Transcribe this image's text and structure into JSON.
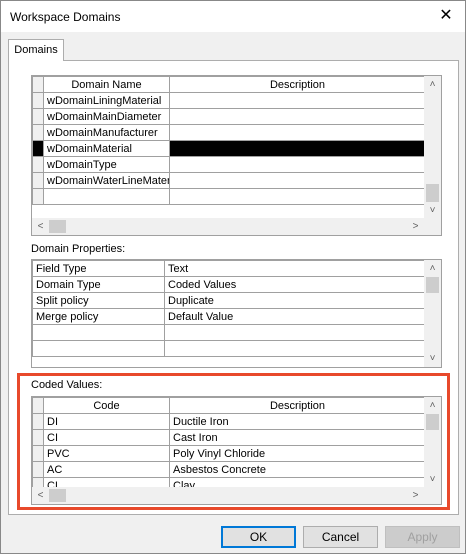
{
  "window": {
    "title": "Workspace Domains",
    "close_glyph": "✕"
  },
  "tabs": [
    {
      "label": "Domains"
    }
  ],
  "domains_table": {
    "headers": {
      "name": "Domain Name",
      "description": "Description"
    },
    "rows": [
      {
        "name": "wDomainLiningMaterial",
        "description": ""
      },
      {
        "name": "wDomainMainDiameter",
        "description": ""
      },
      {
        "name": "wDomainManufacturer",
        "description": ""
      },
      {
        "name": "wDomainMaterial",
        "description": ""
      },
      {
        "name": "wDomainType",
        "description": ""
      },
      {
        "name": "wDomainWaterLineMateri",
        "description": ""
      }
    ]
  },
  "domain_properties": {
    "label": "Domain Properties:",
    "rows": [
      {
        "property": "Field Type",
        "value": "Text"
      },
      {
        "property": "Domain Type",
        "value": "Coded Values"
      },
      {
        "property": "Split policy",
        "value": "Duplicate"
      },
      {
        "property": "Merge policy",
        "value": "Default Value"
      }
    ]
  },
  "coded_values": {
    "label": "Coded Values:",
    "headers": {
      "code": "Code",
      "description": "Description"
    },
    "rows": [
      {
        "code": "DI",
        "description": "Ductile Iron"
      },
      {
        "code": "CI",
        "description": "Cast Iron"
      },
      {
        "code": "PVC",
        "description": "Poly Vinyl Chloride"
      },
      {
        "code": "AC",
        "description": "Asbestos Concrete"
      },
      {
        "code": "CL",
        "description": "Clay"
      }
    ]
  },
  "buttons": {
    "ok": "OK",
    "cancel": "Cancel",
    "apply": "Apply"
  },
  "colors": {
    "highlight": "#e8492b",
    "selection": "#000000",
    "focus": "#0078d7"
  }
}
